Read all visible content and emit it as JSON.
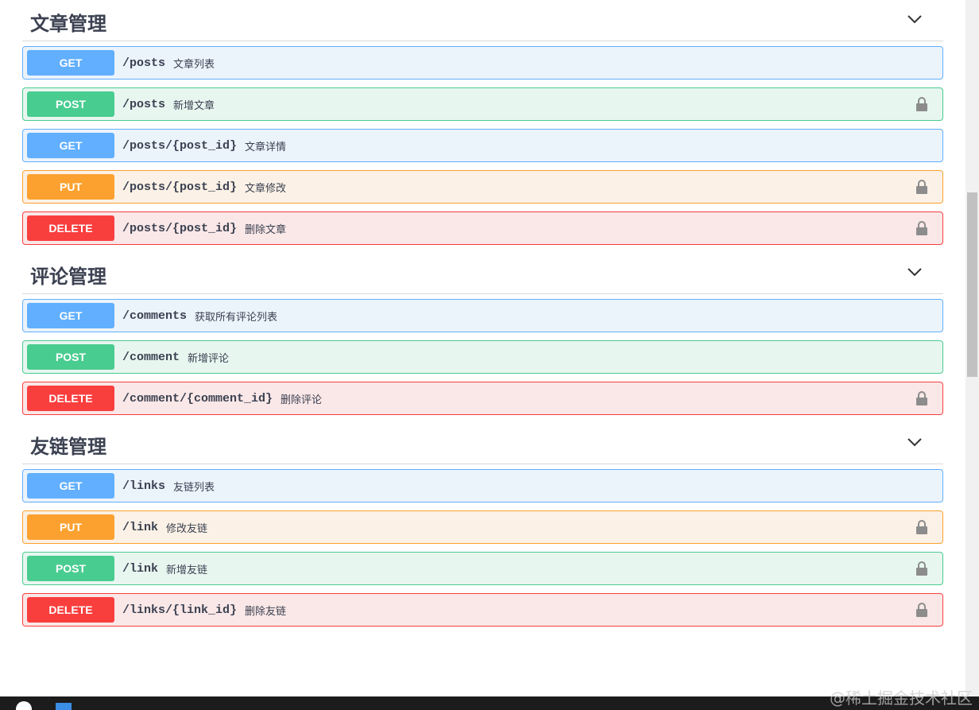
{
  "sections": [
    {
      "title": "文章管理",
      "ops": [
        {
          "method": "GET",
          "path": "/posts",
          "summary": "文章列表",
          "locked": false
        },
        {
          "method": "POST",
          "path": "/posts",
          "summary": "新增文章",
          "locked": true
        },
        {
          "method": "GET",
          "path": "/posts/{post_id}",
          "summary": "文章详情",
          "locked": false
        },
        {
          "method": "PUT",
          "path": "/posts/{post_id}",
          "summary": "文章修改",
          "locked": true
        },
        {
          "method": "DELETE",
          "path": "/posts/{post_id}",
          "summary": "删除文章",
          "locked": true
        }
      ]
    },
    {
      "title": "评论管理",
      "ops": [
        {
          "method": "GET",
          "path": "/comments",
          "summary": "获取所有评论列表",
          "locked": false
        },
        {
          "method": "POST",
          "path": "/comment",
          "summary": "新增评论",
          "locked": false
        },
        {
          "method": "DELETE",
          "path": "/comment/{comment_id}",
          "summary": "删除评论",
          "locked": true
        }
      ]
    },
    {
      "title": "友链管理",
      "ops": [
        {
          "method": "GET",
          "path": "/links",
          "summary": "友链列表",
          "locked": false
        },
        {
          "method": "PUT",
          "path": "/link",
          "summary": "修改友链",
          "locked": true
        },
        {
          "method": "POST",
          "path": "/link",
          "summary": "新增友链",
          "locked": true
        },
        {
          "method": "DELETE",
          "path": "/links/{link_id}",
          "summary": "删除友链",
          "locked": true
        }
      ]
    }
  ],
  "icons": {
    "collapse": "chevron-down-icon",
    "lock": "lock-icon"
  },
  "colors": {
    "get": "#61affe",
    "post": "#49cc90",
    "put": "#fca130",
    "delete": "#f93e3e"
  },
  "watermark": "@稀土掘金技术社区"
}
